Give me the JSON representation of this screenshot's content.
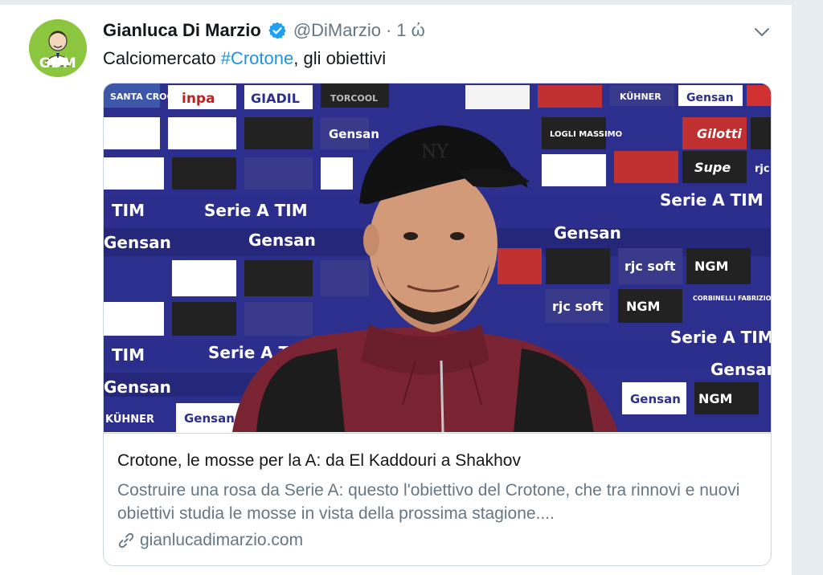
{
  "author": {
    "name": "Gianluca Di Marzio",
    "handle": "@DiMarzio",
    "separator": "·",
    "time": "1 ώ",
    "avatar_text": "GDM"
  },
  "tweet": {
    "text_before": "Calciomercato ",
    "hashtag": "#Crotone",
    "text_after": ", gli obiettivi"
  },
  "card": {
    "title": "Crotone, le mosse per la A: da El Kaddouri a Shakhov",
    "description": "Costruire una rosa da Serie A: questo l'obiettivo del Crotone, che tra rinnovi e nuovi obiettivi studia le mosse in vista della prossima stagione....",
    "domain": "gianlucadimarzio.com"
  },
  "backdrop": {
    "sponsors": [
      "SANTA CROCE",
      "inpa",
      "GIADIL",
      "TORCOOL",
      "Gensan",
      "LOGLI MASSIMO",
      "KÜHNER",
      "Gensan",
      "Gilotti",
      "Supe",
      "rjc",
      "TIM",
      "Serie A TIM",
      "Gensan",
      "rjc soft",
      "NGM",
      "CORBINELLI FABRIZIO"
    ]
  },
  "colors": {
    "accent": "#1b95e0",
    "verified": "#1da1f2",
    "muted": "#657786",
    "backdrop": "#2d2f8f",
    "avatar_bg": "#8cc63f"
  }
}
